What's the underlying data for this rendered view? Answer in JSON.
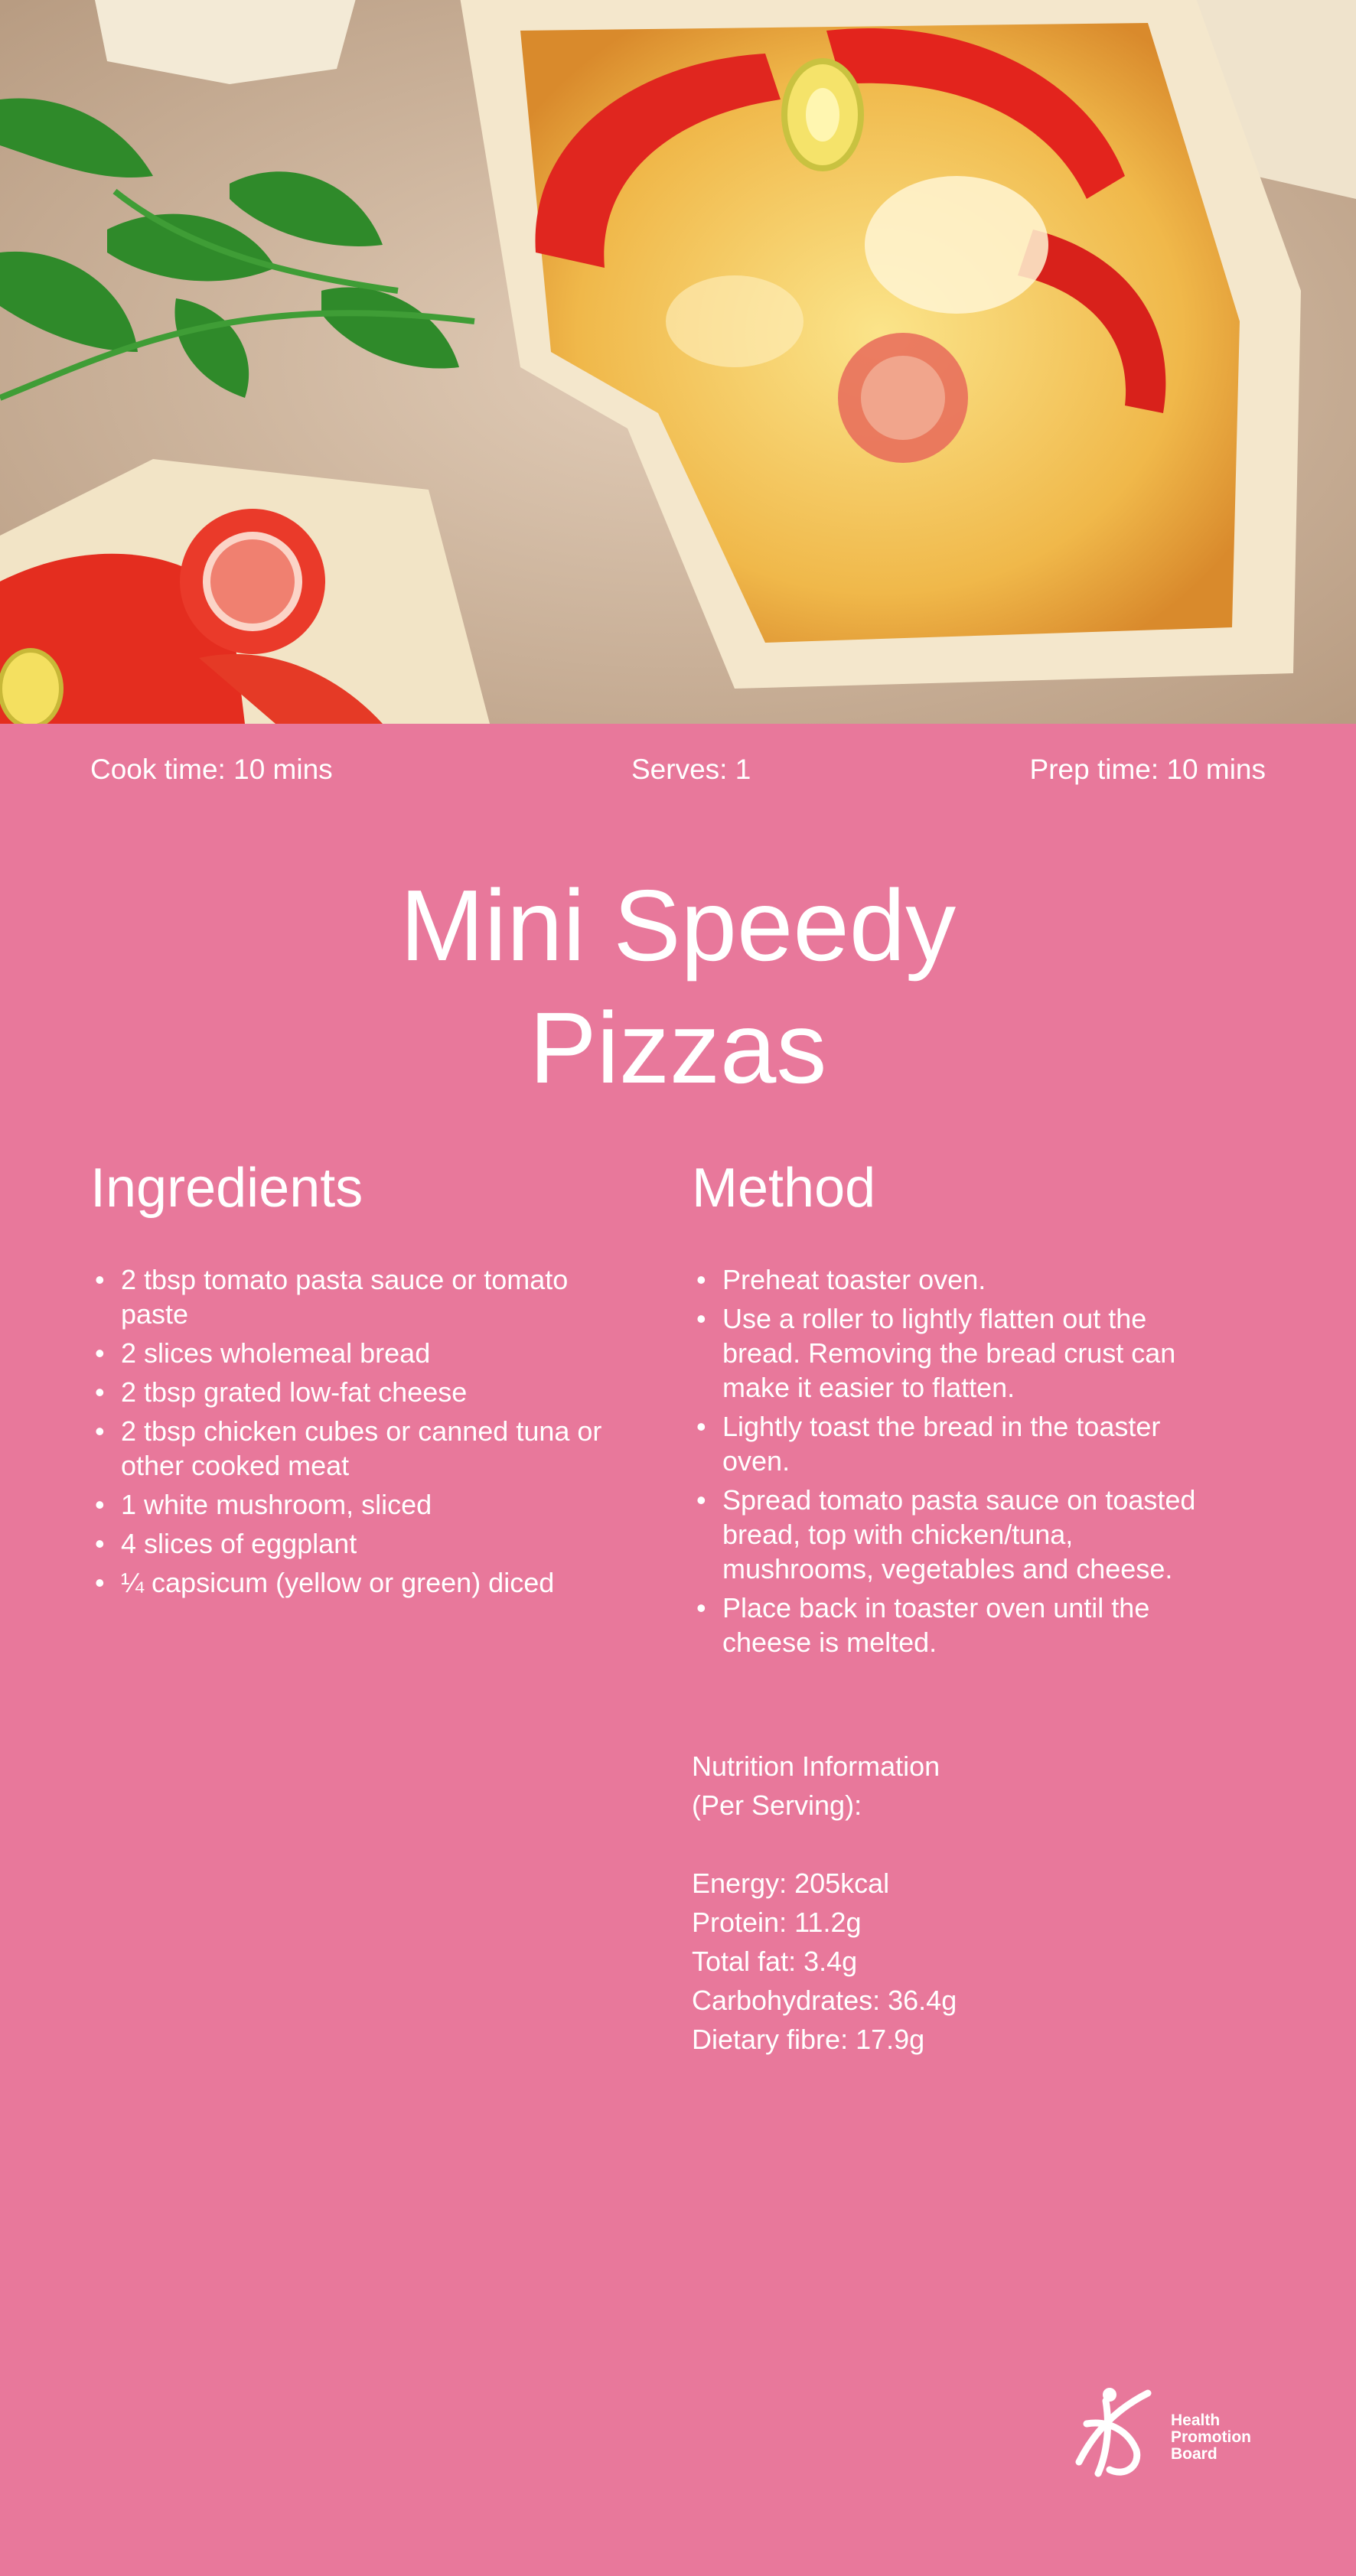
{
  "meta": {
    "cook_time": "Cook time: 10 mins",
    "serves": "Serves: 1",
    "prep_time": "Prep time: 10 mins"
  },
  "title": {
    "line1": "Mini Speedy",
    "line2": "Pizzas"
  },
  "ingredients": {
    "heading": "Ingredients",
    "items": [
      "2 tbsp tomato pasta sauce or tomato paste",
      "2 slices wholemeal bread",
      "2 tbsp grated low-fat cheese",
      "2 tbsp chicken cubes or canned tuna or other cooked meat",
      "1 white mushroom, sliced",
      "4 slices of eggplant",
      "¼ capsicum (yellow or green) diced"
    ]
  },
  "method": {
    "heading": "Method",
    "steps": [
      "Preheat toaster oven.",
      "Use a roller to lightly flatten out the bread. Removing the bread crust can make it easier to flatten.",
      "Lightly toast the bread in the toaster oven.",
      "Spread tomato pasta sauce on toasted bread, top with chicken/tuna, mushrooms, vegetables and cheese.",
      "Place back in toaster oven until the cheese is melted."
    ]
  },
  "nutrition": {
    "heading": "Nutrition Information",
    "subheading": "(Per Serving):",
    "items": [
      "Energy: 205kcal",
      "Protein: 11.2g",
      "Total fat: 3.4g",
      "Carbohydrates: 36.4g",
      "Dietary fibre: 17.9g"
    ]
  },
  "logo": {
    "line1": "Health",
    "line2": "Promotion",
    "line3": "Board"
  },
  "colors": {
    "background": "#e8789b",
    "text": "#ffffff"
  }
}
